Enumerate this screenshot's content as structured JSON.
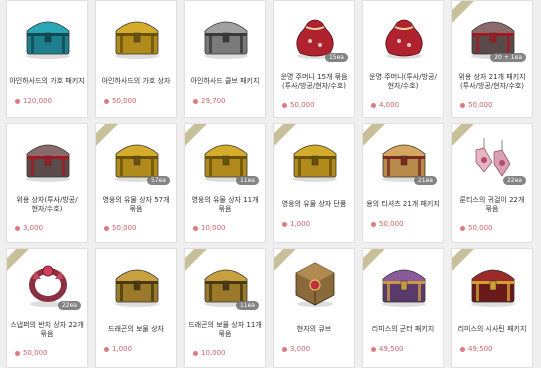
{
  "colors": {
    "price": "#d0606a",
    "card_border": "#e0e0e0",
    "ribbon": "#c8c09a",
    "page_bg": "#efefef"
  },
  "items": [
    {
      "name": "아인하사드의 가호 패키지",
      "price": "120,000",
      "badge": "",
      "ribbon": false,
      "icon": "teal-chest-icon"
    },
    {
      "name": "아인하사드의 가호 상자",
      "price": "50,000",
      "badge": "",
      "ribbon": false,
      "icon": "gold-chest-icon"
    },
    {
      "name": "아인하사드 클브 패키지",
      "price": "29,700",
      "badge": "",
      "ribbon": false,
      "icon": "silver-chest-icon"
    },
    {
      "name": "운명 주머니 15개 묶음 (투사/방공/현자/수호)",
      "price": "50,000",
      "badge": "15ea",
      "ribbon": false,
      "icon": "red-pouch-icon"
    },
    {
      "name": "운명 주머니(투사/방공/현자/수호)",
      "price": "4,000",
      "badge": "",
      "ribbon": false,
      "icon": "red-pouch-icon"
    },
    {
      "name": "위용 상자 21개 패키지 (투사/방공/현자/수호)",
      "price": "50,000",
      "badge": "20 + 1ea",
      "ribbon": true,
      "icon": "dark-red-chest-icon"
    },
    {
      "name": "위용 상자(투사/방공/현자/수호)",
      "price": "3,000",
      "badge": "",
      "ribbon": false,
      "icon": "dark-red-chest-icon"
    },
    {
      "name": "영웅의 유물 상자 57개 묶음",
      "price": "50,000",
      "badge": "57ea",
      "ribbon": true,
      "icon": "gold-chest-icon"
    },
    {
      "name": "영웅의 유물 상자 11개 묶음",
      "price": "10,000",
      "badge": "11ea",
      "ribbon": true,
      "icon": "gold-chest-icon"
    },
    {
      "name": "영웅의 유물 상자 단품",
      "price": "1,000",
      "badge": "",
      "ribbon": true,
      "icon": "gold-chest-icon"
    },
    {
      "name": "용의 티셔츠 21개 패키지",
      "price": "50,000",
      "badge": "21ea",
      "ribbon": true,
      "icon": "tan-chest-icon"
    },
    {
      "name": "룬티스의 귀걸이 22개 묶음",
      "price": "50,000",
      "badge": "22ea",
      "ribbon": true,
      "icon": "earring-icon"
    },
    {
      "name": "스냅퍼의 반지 상자 22개 묶음",
      "price": "50,000",
      "badge": "22ea",
      "ribbon": true,
      "icon": "ring-icon"
    },
    {
      "name": "드래곤의 보물 상자",
      "price": "1,000",
      "badge": "",
      "ribbon": false,
      "icon": "dragon-chest-icon"
    },
    {
      "name": "드래곤의 보물 상자 11개 묶음",
      "price": "10,000",
      "badge": "11ea",
      "ribbon": true,
      "icon": "dragon-chest-icon"
    },
    {
      "name": "현자의 큐브",
      "price": "3,000",
      "badge": "",
      "ribbon": true,
      "icon": "cube-icon"
    },
    {
      "name": "리미스의 군터 패키지",
      "price": "49,500",
      "badge": "",
      "ribbon": true,
      "icon": "purple-chest-icon"
    },
    {
      "name": "리미스의 시사틴 패키지",
      "price": "49,500",
      "badge": "",
      "ribbon": true,
      "icon": "ruby-chest-icon"
    }
  ]
}
